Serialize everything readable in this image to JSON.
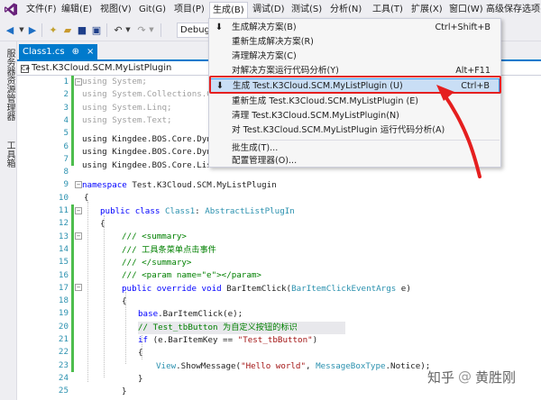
{
  "menubar": {
    "items": [
      "文件(F)",
      "编辑(E)",
      "视图(V)",
      "Git(G)",
      "项目(P)",
      "生成(B)",
      "调试(D)",
      "测试(S)",
      "分析(N)",
      "工具(T)",
      "扩展(X)",
      "窗口(W)",
      "高级保存选项("
    ]
  },
  "toolbar": {
    "config": "Debug",
    "icons": [
      "back-icon",
      "forward-icon",
      "new-project-icon",
      "open-icon",
      "save-icon",
      "save-all-icon",
      "undo-icon",
      "redo-icon"
    ]
  },
  "sidetabs": [
    "服务器资源管理器",
    "工具箱"
  ],
  "doctab": {
    "label": "Class1.cs",
    "close": "×",
    "pin": "⊕"
  },
  "navbar": {
    "label": "Test.K3Cloud.SCM.MyListPlugin"
  },
  "gutter": [
    "1",
    "2",
    "3",
    "4",
    "5",
    "6",
    "7",
    "8",
    "9",
    "10",
    "11",
    "12",
    "13",
    "14",
    "15",
    "16",
    "17",
    "18",
    "19",
    "20",
    "21",
    "22",
    "23",
    "24",
    "25",
    "26",
    "27",
    "28",
    "29",
    "30",
    "31",
    "32",
    "33",
    "34",
    "35",
    "36",
    "37",
    "38",
    "39",
    "40",
    "41"
  ],
  "code": {
    "l1": "using System;",
    "l2": "using System.Collections.Ge",
    "l3": "using System.Linq;",
    "l4": "using System.Text;",
    "l6": "using Kingdee.BOS.Core.Dyna",
    "l7": "using Kingdee.BOS.Core.Dyna",
    "l8": "using Kingdee.BOS.Core.List",
    "l10_kw": "namespace",
    "l10_name": " Test.K3Cloud.SCM.MyListPlugin",
    "l11": "{",
    "l12_kw": "public class",
    "l12_type": "Class1",
    "l12_sep": ": ",
    "l12_base": "AbstractListPlugIn",
    "l13": "{",
    "l14": "/// <summary>",
    "l15_pre": "/// ",
    "l15_text": "工具条菜单点击事件",
    "l16": "/// </summary>",
    "l17_pre": "/// <param name=",
    "l17_str": "\"e\"",
    "l17_post": "></param>",
    "l18_kw": "public override void",
    "l18_name": " BarItemClick(",
    "l18_type": "BarItemClickEventArgs",
    "l18_end": " e)",
    "l19": "{",
    "l20_kw": "base",
    "l20_rest": ".BarItemClick(e);",
    "l21": "// Test_tbButton 为自定义按钮的标识",
    "l22_kw": "if",
    "l22_mid": " (e.BarItemKey == ",
    "l22_str": "\"Test_tbButton\"",
    "l22_end": ")",
    "l23": "{",
    "l24_type": "View",
    "l24_mid": ".ShowMessage(",
    "l24_str": "\"Hello world\"",
    "l24_sep": ", ",
    "l24_type2": "MessageBoxType",
    "l24_end": ".Notice);",
    "l25": "}",
    "l26": "}",
    "l27": "}",
    "l28": "}"
  },
  "dropdown": {
    "items": [
      {
        "label": "生成解决方案(B)",
        "shortcut": "Ctrl+Shift+B",
        "icon": "build-icon"
      },
      {
        "label": "重新生成解决方案(R)",
        "shortcut": ""
      },
      {
        "label": "清理解决方案(C)",
        "shortcut": ""
      },
      {
        "label": "对解决方案运行代码分析(Y)",
        "shortcut": "Alt+F11"
      },
      {
        "label": "生成 Test.K3Cloud.SCM.MyListPlugin (U)",
        "shortcut": "Ctrl+B",
        "icon": "build-icon"
      },
      {
        "label": "重新生成 Test.K3Cloud.SCM.MyListPlugin (E)",
        "shortcut": ""
      },
      {
        "label": "清理 Test.K3Cloud.SCM.MyListPlugin(N)",
        "shortcut": ""
      },
      {
        "label": "对 Test.K3Cloud.SCM.MyListPlugin 运行代码分析(A)",
        "shortcut": ""
      },
      {
        "label": "批生成(T)...",
        "shortcut": ""
      },
      {
        "label": "配置管理器(O)...",
        "shortcut": ""
      }
    ]
  },
  "watermark": {
    "site": "知乎",
    "sep": "@",
    "author": "黄胜刚"
  },
  "colors": {
    "accent": "#007acc",
    "highlight": "#e51f1f",
    "keyword": "#0000ff",
    "type": "#2b91af",
    "comment": "#008000",
    "string": "#a31515"
  }
}
